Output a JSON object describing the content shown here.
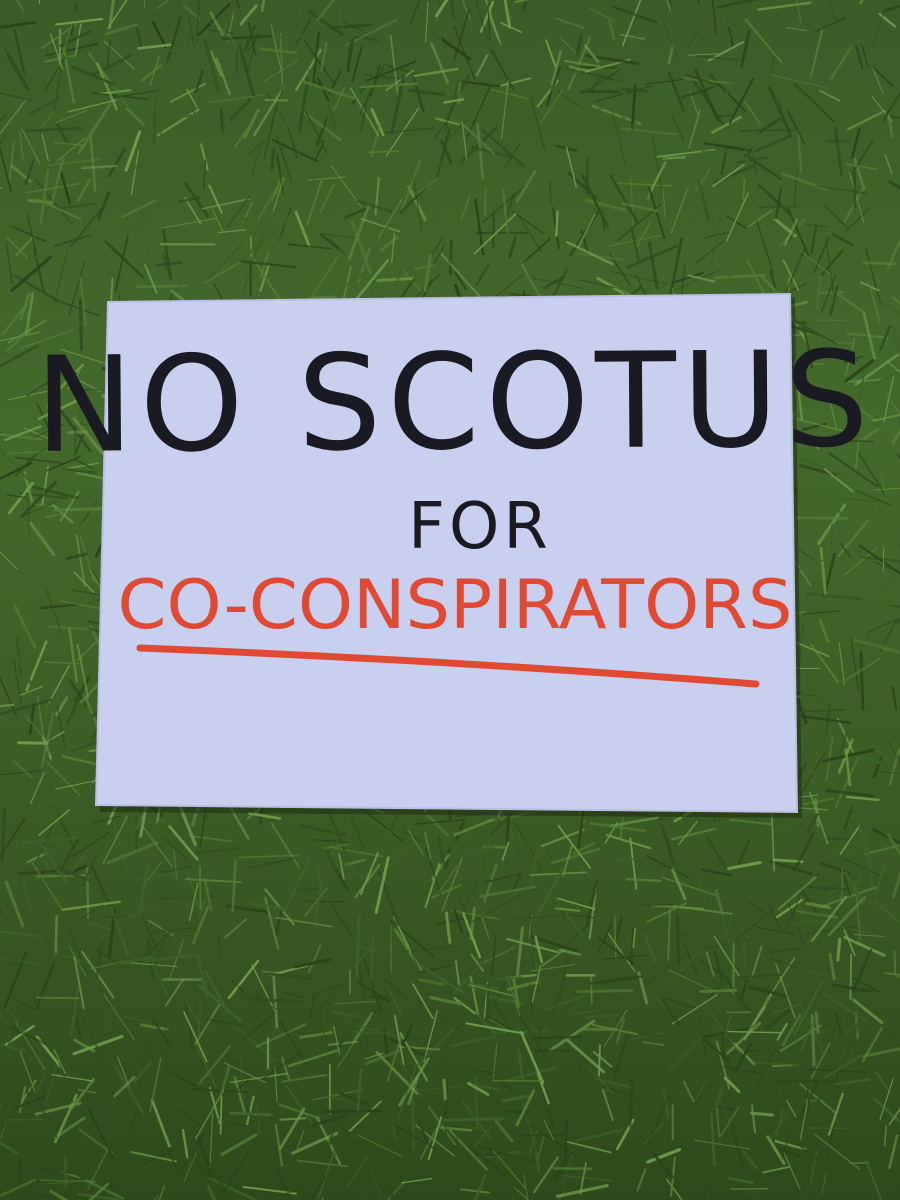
{
  "sign": {
    "line1": "NO SCOTUS",
    "line2": "FOR",
    "line3": "CO-CONSPIRATORS"
  },
  "colors": {
    "grass_dark": "#2a4419",
    "grass_mid": "#3d6228",
    "grass_light": "#6f9a4a",
    "board": "#c9cfef",
    "ink_black": "#1a1a22",
    "ink_red": "#e04a32"
  }
}
